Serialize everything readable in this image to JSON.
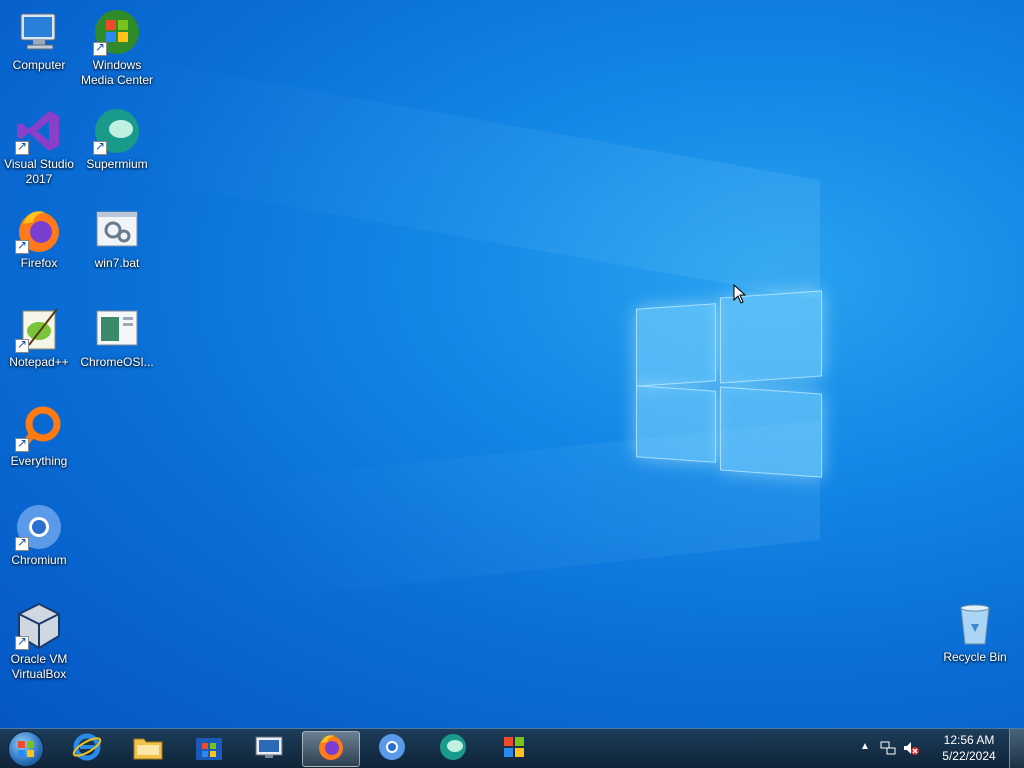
{
  "desktop": {
    "icons": [
      {
        "label": "Computer"
      },
      {
        "label": "Windows Media Center"
      },
      {
        "label": "Visual Studio 2017"
      },
      {
        "label": "Supermium"
      },
      {
        "label": "Firefox"
      },
      {
        "label": "win7.bat"
      },
      {
        "label": "Notepad++"
      },
      {
        "label": "ChromeOSI..."
      },
      {
        "label": "Everything"
      },
      {
        "label": "Chromium"
      },
      {
        "label": "Oracle VM VirtualBox"
      },
      {
        "label": "Recycle Bin"
      }
    ]
  },
  "taskbar": {
    "pinned": [
      {
        "icon": "internet-explorer-icon"
      },
      {
        "icon": "file-explorer-icon"
      },
      {
        "icon": "store-icon"
      },
      {
        "icon": "remote-desktop-icon"
      },
      {
        "icon": "firefox-icon",
        "active": true
      },
      {
        "icon": "chromium-icon"
      },
      {
        "icon": "supermium-icon"
      },
      {
        "icon": "windows-flag-icon"
      }
    ],
    "tray": {
      "time": "12:56 AM",
      "date": "5/22/2024"
    }
  },
  "colors": {
    "desktop_bg": "#0a6fd6",
    "taskbar_bg": "#1d3d5a"
  }
}
